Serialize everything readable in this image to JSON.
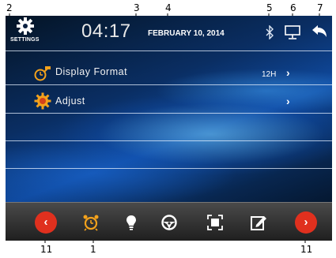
{
  "callouts": {
    "c2": "2",
    "c3": "3",
    "c4": "4",
    "c5": "5",
    "c6": "6",
    "c7": "7",
    "c11_left": "11",
    "c1": "1",
    "c11_right": "11"
  },
  "header": {
    "settings_label": "SETTINGS",
    "time": "04:17",
    "date": "FEBRUARY 10, 2014",
    "icons": [
      "gear-icon",
      "bluetooth-icon",
      "monitor-icon",
      "back-arrow-icon"
    ]
  },
  "rows": [
    {
      "label": "Display Format",
      "value": "12H",
      "chevron": "›",
      "icon": "clock-key-icon"
    },
    {
      "label": "Adjust",
      "value": "",
      "chevron": "›",
      "icon": "sun-gear-icon"
    }
  ],
  "bottom": {
    "prev": "‹",
    "next": "›",
    "icons": [
      "alarm-clock-icon",
      "lightbulb-icon",
      "steering-wheel-icon",
      "screen-frame-icon",
      "edit-icon"
    ]
  },
  "colors": {
    "accent_red": "#e0301e",
    "highlight_orange": "#f4a21c"
  }
}
